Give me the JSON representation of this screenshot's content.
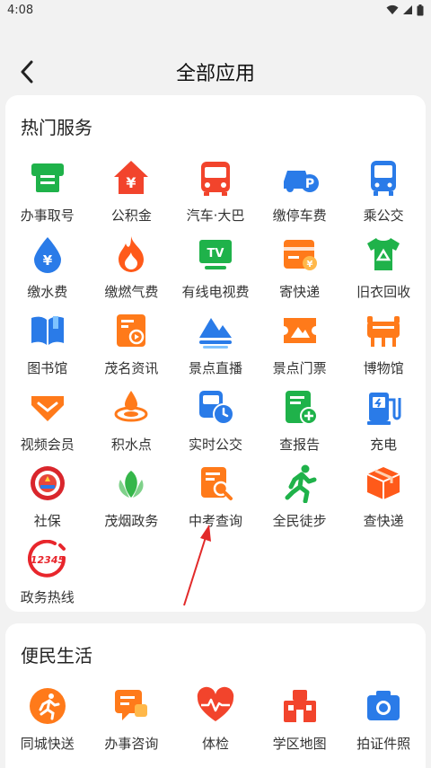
{
  "status": {
    "time": "4:08"
  },
  "header": {
    "title": "全部应用"
  },
  "hot": {
    "title": "热门服务",
    "items": [
      {
        "label": "办事取号",
        "icon": "ticket-machine-icon"
      },
      {
        "label": "公积金",
        "icon": "house-fund-icon"
      },
      {
        "label": "汽车·大巴",
        "icon": "bus-icon"
      },
      {
        "label": "缴停车费",
        "icon": "parking-car-icon"
      },
      {
        "label": "乘公交",
        "icon": "transit-bus-icon"
      },
      {
        "label": "缴水费",
        "icon": "water-drop-icon"
      },
      {
        "label": "缴燃气费",
        "icon": "gas-flame-icon"
      },
      {
        "label": "有线电视费",
        "icon": "tv-icon"
      },
      {
        "label": "寄快递",
        "icon": "parcel-card-icon"
      },
      {
        "label": "旧衣回收",
        "icon": "recycle-shirt-icon"
      },
      {
        "label": "图书馆",
        "icon": "book-icon"
      },
      {
        "label": "茂名资讯",
        "icon": "news-play-icon"
      },
      {
        "label": "景点直播",
        "icon": "mountain-live-icon"
      },
      {
        "label": "景点门票",
        "icon": "scenic-ticket-icon"
      },
      {
        "label": "博物馆",
        "icon": "museum-cauldron-icon"
      },
      {
        "label": "视频会员",
        "icon": "vip-diamond-icon"
      },
      {
        "label": "积水点",
        "icon": "water-ripple-icon"
      },
      {
        "label": "实时公交",
        "icon": "bus-clock-icon"
      },
      {
        "label": "查报告",
        "icon": "report-plus-icon"
      },
      {
        "label": "充电",
        "icon": "charging-station-icon"
      },
      {
        "label": "社保",
        "icon": "social-security-badge-icon"
      },
      {
        "label": "茂烟政务",
        "icon": "tobacco-leaf-icon"
      },
      {
        "label": "中考查询",
        "icon": "exam-search-icon"
      },
      {
        "label": "全民徒步",
        "icon": "walking-person-icon"
      },
      {
        "label": "查快递",
        "icon": "package-box-icon"
      },
      {
        "label": "政务热线",
        "icon": "hotline-12345-icon"
      }
    ]
  },
  "life": {
    "title": "便民生活",
    "items": [
      {
        "label": "同城快送",
        "icon": "runner-icon"
      },
      {
        "label": "办事咨询",
        "icon": "chat-bubble-icon"
      },
      {
        "label": "体检",
        "icon": "heart-pulse-icon"
      },
      {
        "label": "学区地图",
        "icon": "school-building-icon"
      },
      {
        "label": "拍证件照",
        "icon": "camera-icon"
      }
    ]
  },
  "colors": {
    "orange": "#ff6a1a",
    "green": "#1fb24a",
    "blue": "#2a7be8",
    "red": "#f2442c"
  }
}
